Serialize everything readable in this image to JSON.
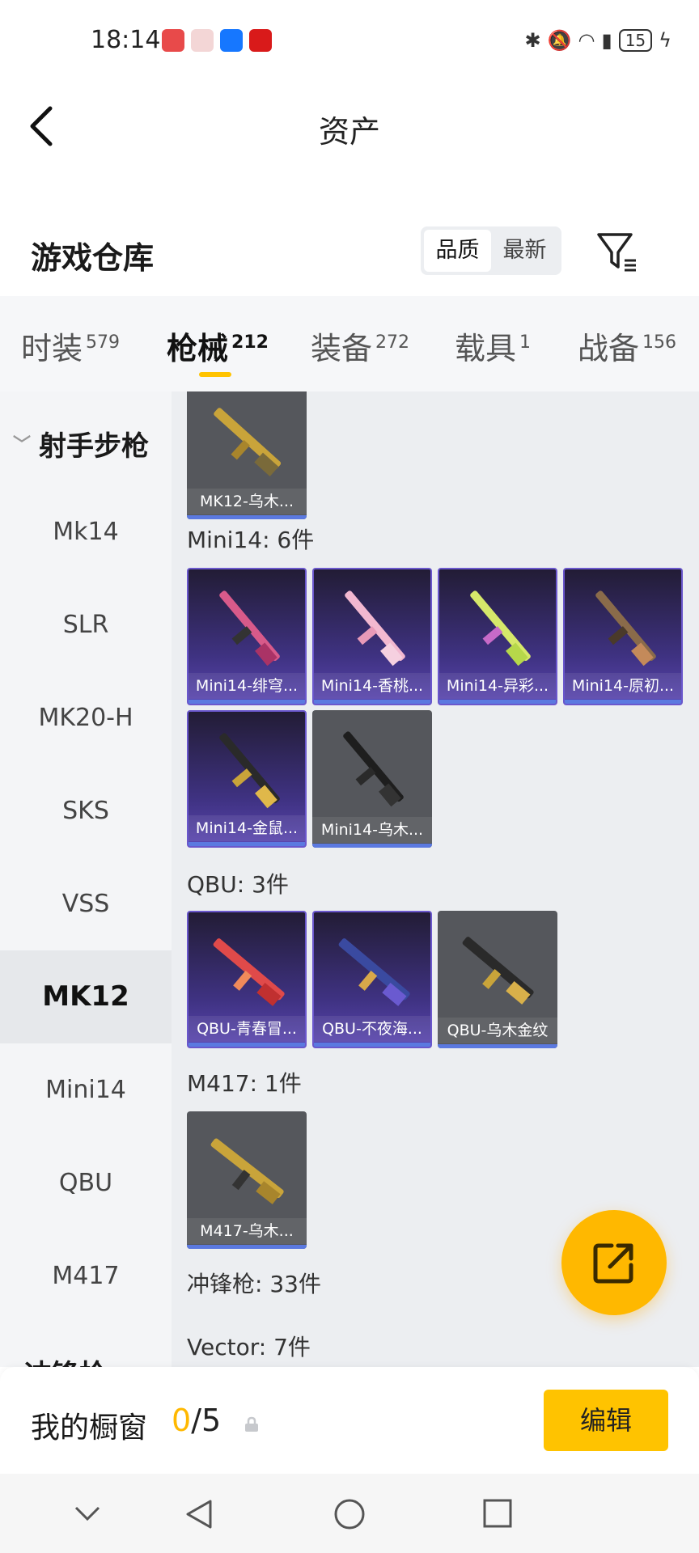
{
  "status_bar": {
    "time": "18:14",
    "battery": "15"
  },
  "header": {
    "back_label": "",
    "title": "资产"
  },
  "warehouse": {
    "title": "游戏仓库",
    "sort_options": [
      "品质",
      "最新"
    ],
    "sort_selected": "品质"
  },
  "tabs": [
    {
      "label": "时装",
      "count": "579"
    },
    {
      "label": "枪械",
      "count": "212"
    },
    {
      "label": "装备",
      "count": "272"
    },
    {
      "label": "载具",
      "count": "1"
    },
    {
      "label": "战备",
      "count": "156"
    }
  ],
  "active_tab": "枪械",
  "sidebar": {
    "group": "射手步枪",
    "items": [
      "Mk14",
      "SLR",
      "MK20-H",
      "SKS",
      "VSS",
      "MK12",
      "Mini14",
      "QBU",
      "M417"
    ],
    "active_item": "MK12",
    "next_group": "冲锋枪"
  },
  "content": {
    "top_item": "MK12-乌木...",
    "sections": [
      {
        "heading": "Mini14: 6件",
        "items": [
          "Mini14-绯穹...",
          "Mini14-香桃...",
          "Mini14-异彩...",
          "Mini14-原初...",
          "Mini14-金鼠...",
          "Mini14-乌木..."
        ]
      },
      {
        "heading": "QBU: 3件",
        "items": [
          "QBU-青春冒...",
          "QBU-不夜海...",
          "QBU-乌木金纹"
        ]
      },
      {
        "heading": "M417: 1件",
        "items": [
          "M417-乌木..."
        ]
      }
    ],
    "smg_heading": "冲锋枪: 33件",
    "vector_heading": "Vector: 7件"
  },
  "showcase": {
    "title": "我的橱窗",
    "count_current": "0",
    "count_total": "/5",
    "edit_label": "编辑"
  },
  "colors": {
    "accent": "#ffc300",
    "card_purple": "#3f3282",
    "card_gray": "#55575c",
    "card_bar": "#5b79e0"
  },
  "icons": [
    "back-arrow-icon",
    "filter-icon",
    "share-icon",
    "lock-icon",
    "nav-down-icon",
    "nav-back-icon",
    "nav-home-icon",
    "nav-recent-icon"
  ]
}
